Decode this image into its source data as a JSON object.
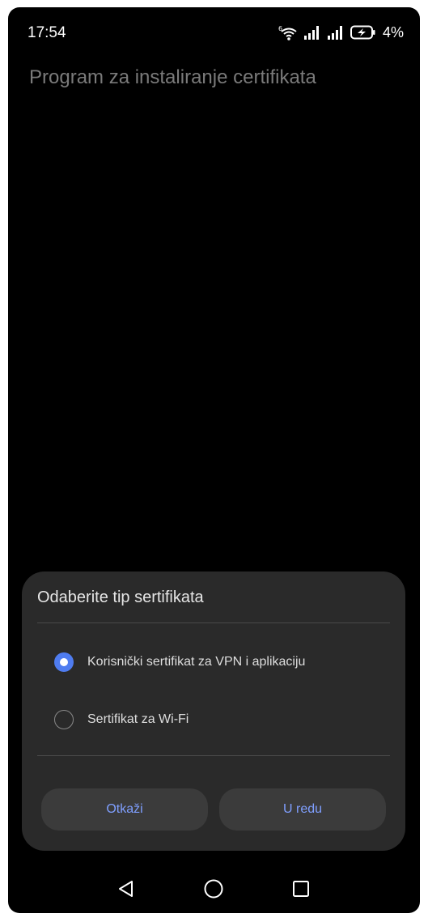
{
  "status_bar": {
    "time": "17:54",
    "wifi_label": "6",
    "battery_percent": "4%",
    "icons": [
      "wifi-6-icon",
      "signal-bars-icon",
      "signal-bars-icon",
      "battery-charging-icon"
    ]
  },
  "app": {
    "title": "Program za instaliranje certifikata"
  },
  "dialog": {
    "title": "Odaberite tip sertifikata",
    "options": [
      {
        "label": "Korisnički sertifikat za VPN i aplikaciju",
        "selected": true
      },
      {
        "label": "Sertifikat za Wi-Fi",
        "selected": false
      }
    ],
    "cancel_label": "Otkaži",
    "ok_label": "U redu"
  },
  "nav_bar": {
    "icons": [
      "back-triangle-icon",
      "home-circle-icon",
      "recents-square-icon"
    ]
  },
  "colors": {
    "accent": "#4f7cf0",
    "button_text": "#7f9fff",
    "dialog_bg": "#2a2a2a",
    "screen_bg": "#000000"
  }
}
